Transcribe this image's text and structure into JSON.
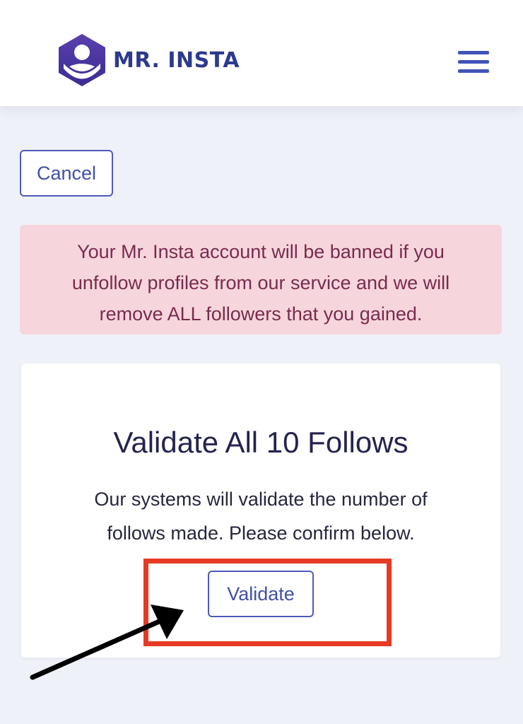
{
  "header": {
    "brand": "MR. INSTA",
    "logo_icon": "user-hexagon-logo",
    "menu_icon": "hamburger-menu-icon"
  },
  "actions": {
    "cancel_label": "Cancel"
  },
  "alert": {
    "message": "Your Mr. Insta account will be banned if you unfollow profiles from our service and we will remove ALL followers that you gained."
  },
  "card": {
    "title": "Validate All 10 Follows",
    "description": "Our systems will validate the number of follows made. Please confirm below.",
    "validate_label": "Validate"
  },
  "annotations": {
    "highlight_color": "#e63a24",
    "arrow_color": "#000000"
  },
  "colors": {
    "brand": "#2d3a8c",
    "accent": "#4d5ab9",
    "alert_bg": "#f6d6dc",
    "alert_text": "#7a2b4f"
  }
}
